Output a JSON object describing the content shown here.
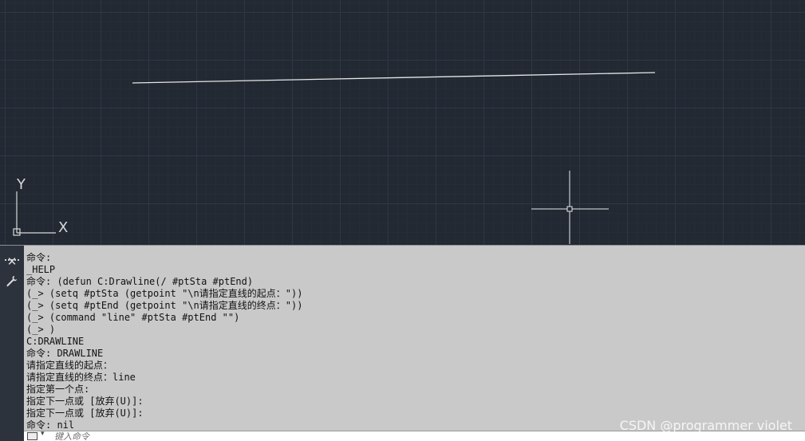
{
  "canvas": {
    "background_color": "#222933",
    "line_color": "#e6e6e6",
    "ucs": {
      "x_label": "X",
      "y_label": "Y"
    }
  },
  "command_panel": {
    "side_strip_icons": [
      "grip-icon",
      "close-icon",
      "wrench-icon"
    ],
    "history": [
      "命令:",
      "_HELP",
      "命令: (defun C:Drawline(/ #ptSta #ptEnd)",
      "(_> (setq #ptSta (getpoint \"\\n请指定直线的起点：\"))",
      "(_> (setq #ptEnd (getpoint \"\\n请指定直线的终点：\"))",
      "(_> (command \"line\" #ptSta #ptEnd \"\")",
      "(_> )",
      "C:DRAWLINE",
      "命令: DRAWLINE",
      "请指定直线的起点：",
      "请指定直线的终点：line",
      "指定第一个点:",
      "指定下一点或 [放弃(U)]:",
      "指定下一点或 [放弃(U)]:",
      "命令: nil"
    ],
    "input": {
      "value": "",
      "placeholder": "键入命令"
    }
  },
  "watermark": "CSDN @programmer violet"
}
